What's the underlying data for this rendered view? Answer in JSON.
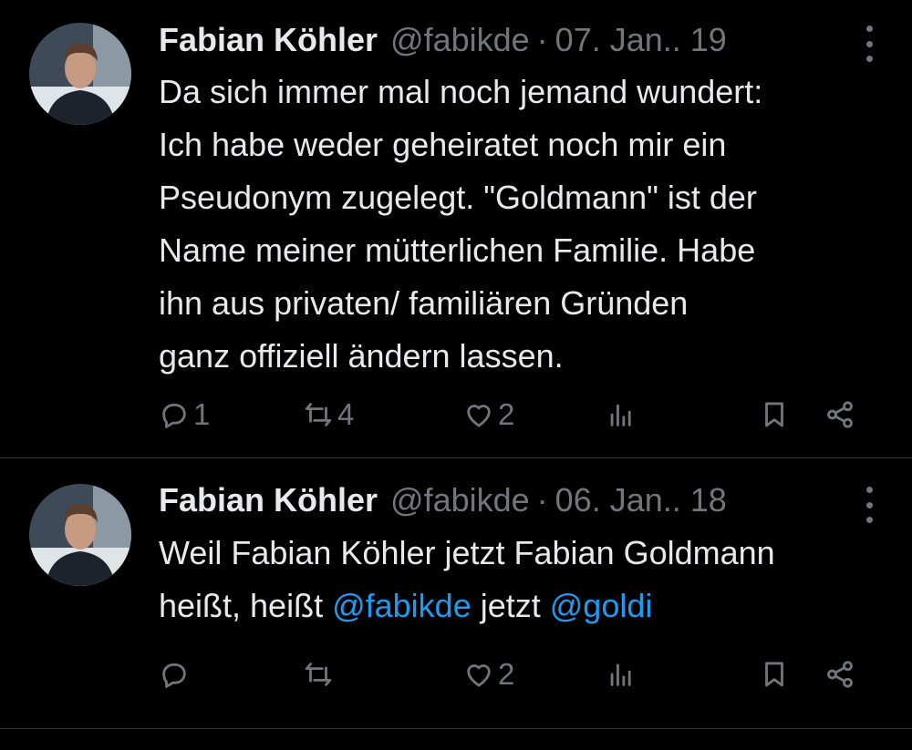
{
  "tweets": [
    {
      "name": "Fabian Köhler",
      "handle": "@fabikde",
      "separator": "·",
      "date": "07. Jan.. 19",
      "text": "Da sich immer mal noch jemand wundert: Ich habe weder geheiratet noch mir ein Pseudonym zugelegt. \"Goldmann\" ist der Name meiner mütterlichen Familie. Habe ihn aus privaten/ familiären Gründen ganz offiziell ändern lassen.",
      "lines": [
        "Da sich immer mal noch jemand wundert:",
        "Ich habe weder geheiratet noch mir ein",
        "Pseudonym zugelegt. \"Goldmann\" ist der",
        "Name meiner mütterlichen Familie. Habe",
        "ihn aus privaten/ familiären Gründen",
        "ganz offiziell ändern lassen."
      ],
      "replies": "1",
      "retweets": "4",
      "likes": "2"
    },
    {
      "name": "Fabian Köhler",
      "handle": "@fabikde",
      "separator": "·",
      "date": "06. Jan.. 18",
      "text_line1": "Weil Fabian Köhler jetzt Fabian Goldmann",
      "text_line2_a": "heißt, heißt ",
      "mention1": "@fabikde",
      "text_line2_b": " jetzt ",
      "mention2": "@goldi",
      "replies": "",
      "retweets": "",
      "likes": "2"
    }
  ],
  "icons": [
    "reply-icon",
    "retweet-icon",
    "like-icon",
    "views-icon",
    "bookmark-icon",
    "share-icon",
    "more-icon"
  ],
  "colors": {
    "background": "#000000",
    "text": "#e7e9ea",
    "muted": "#71767b",
    "link": "#1d9bf0",
    "divider": "#2f3336"
  }
}
